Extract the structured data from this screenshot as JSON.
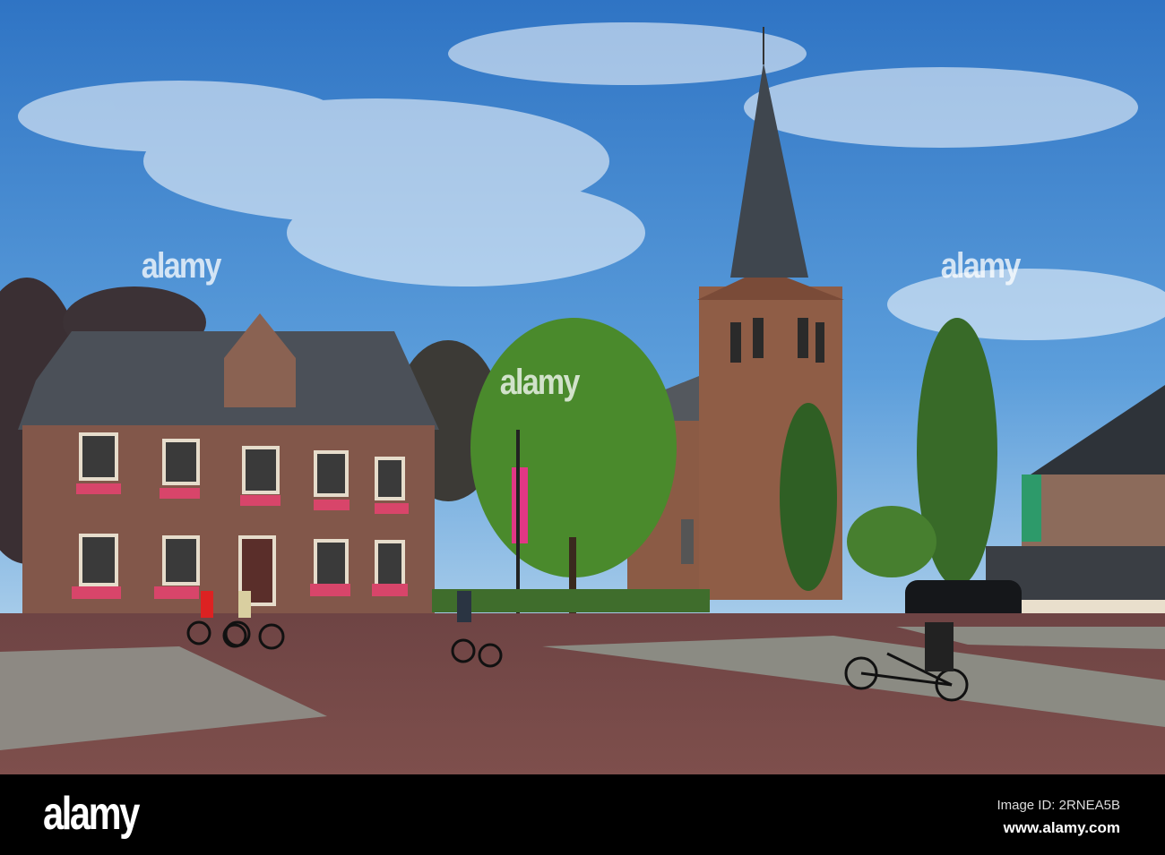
{
  "photo": {
    "subject": "town square with brick town hall, church tower and cyclists",
    "colors": {
      "sky": "#3f84cc",
      "brick": "#8a5a44",
      "pavement": "#7a4a46",
      "roof": "#4a5057",
      "foliage": "#3f7a2a"
    }
  },
  "watermark": {
    "text": "alamy"
  },
  "footer": {
    "logo": "alamy",
    "image_id": "Image ID: 2RNEA5B",
    "url": "www.alamy.com"
  }
}
